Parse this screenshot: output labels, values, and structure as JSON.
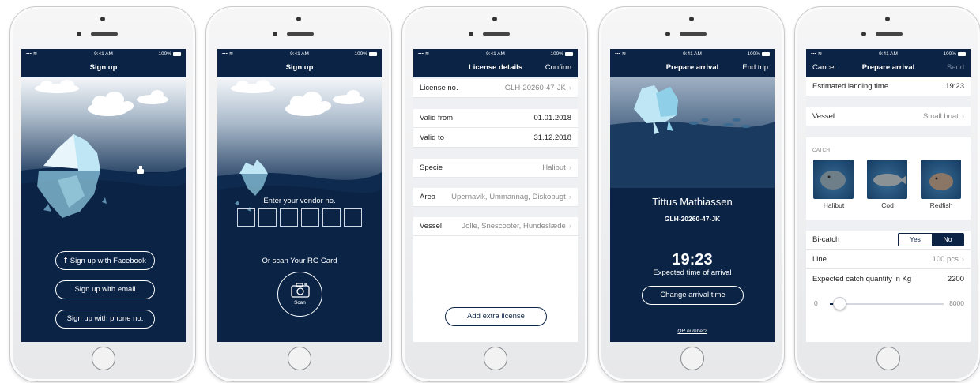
{
  "status": {
    "time": "9:41 AM",
    "battery": "100%"
  },
  "screen1": {
    "title": "Sign up",
    "facebook": "Sign up with Facebook",
    "email": "Sign up with email",
    "phone": "Sign up with phone no."
  },
  "screen2": {
    "title": "Sign up",
    "prompt": "Enter your vendor no.",
    "or_scan": "Or scan Your RG Card",
    "scan": "Scan"
  },
  "screen3": {
    "title": "License details",
    "confirm": "Confirm",
    "rows": [
      {
        "label": "License no.",
        "value": "GLH-20260-47-JK"
      },
      {
        "label": "Valid from",
        "value": "01.01.2018"
      },
      {
        "label": "Valid to",
        "value": "31.12.2018"
      },
      {
        "label": "Specie",
        "value": "Halibut"
      },
      {
        "label": "Area",
        "value": "Upernavik, Ummannag, Diskobugt"
      },
      {
        "label": "Vessel",
        "value": "Jolle, Snescooter, Hundeslæde"
      }
    ],
    "add_license": "Add extra license"
  },
  "screen4": {
    "title": "Prepare arrival",
    "end_trip": "End trip",
    "name": "Tittus Mathiassen",
    "license": "GLH-20260-47-JK",
    "time": "19:23",
    "time_label": "Expected time of arrival",
    "change": "Change arrival time",
    "qr": "QR number?"
  },
  "screen5": {
    "cancel": "Cancel",
    "title": "Prepare arrival",
    "send": "Send",
    "landing_label": "Estimated landing time",
    "landing_value": "19:23",
    "vessel_label": "Vessel",
    "vessel_value": "Small boat",
    "catch_header": "CATCH",
    "fish": [
      "Halibut",
      "Cod",
      "Redfish"
    ],
    "bicatch_label": "Bi-catch",
    "yes": "Yes",
    "no": "No",
    "line_label": "Line",
    "line_value": "100 pcs",
    "qty_label": "Expected catch quantity in Kg",
    "qty_value": "2200",
    "slider_min": "0",
    "slider_max": "8000",
    "slider_fraction": 0.08
  },
  "colors": {
    "navy": "#0b2446",
    "accent": "#0b2446",
    "ice": "#bfe6f5"
  }
}
